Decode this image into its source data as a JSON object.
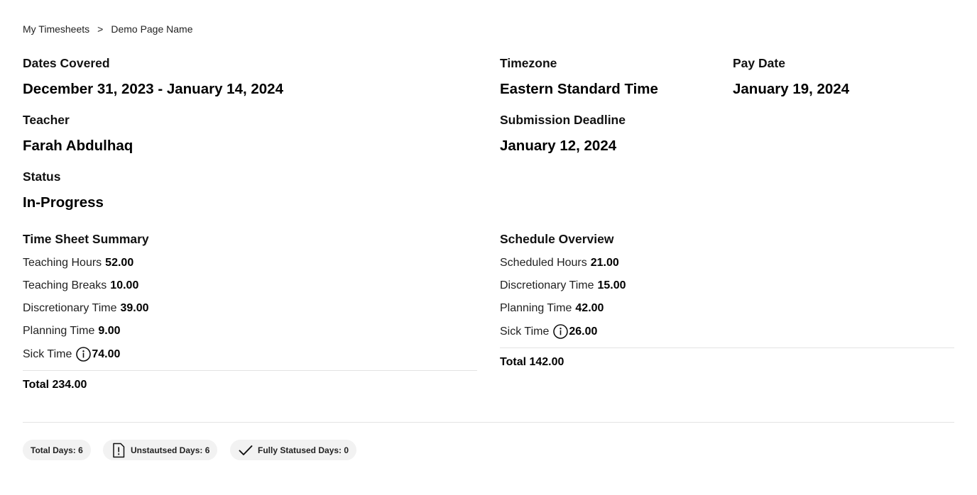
{
  "breadcrumb": {
    "parent": "My Timesheets",
    "separator": ">",
    "current": "Demo Page Name"
  },
  "details": {
    "dates_covered": {
      "label": "Dates Covered",
      "value": "December 31, 2023 - January 14, 2024"
    },
    "timezone": {
      "label": "Timezone",
      "value": "Eastern Standard Time"
    },
    "pay_date": {
      "label": "Pay Date",
      "value": "January 19, 2024"
    },
    "teacher": {
      "label": "Teacher",
      "value": "Farah Abdulhaq"
    },
    "submission_deadline": {
      "label": "Submission Deadline",
      "value": "January 12, 2024"
    },
    "status": {
      "label": "Status",
      "value": "In-Progress"
    }
  },
  "time_sheet_summary": {
    "title": "Time Sheet Summary",
    "rows": [
      {
        "label": "Teaching Hours",
        "value": "52.00"
      },
      {
        "label": "Teaching Breaks",
        "value": "10.00"
      },
      {
        "label": "Discretionary Time",
        "value": "39.00"
      },
      {
        "label": "Planning Time",
        "value": "9.00"
      },
      {
        "label": "Sick Time",
        "value": "74.00",
        "icon": "info-icon"
      }
    ],
    "total": "Total 234.00"
  },
  "schedule_overview": {
    "title": "Schedule Overview",
    "rows": [
      {
        "label": "Scheduled Hours",
        "value": "21.00"
      },
      {
        "label": "Discretionary Time",
        "value": "15.00"
      },
      {
        "label": "Planning Time",
        "value": "42.00"
      },
      {
        "label": "Sick Time",
        "value": "26.00",
        "icon": "info-icon"
      }
    ],
    "total": "Total 142.00"
  },
  "badges": {
    "total_days": "Total Days: 6",
    "unstatused_days": "Unstautsed Days: 6",
    "unstatused_icon": "document-alert-icon",
    "fully_statused_days": "Fully Statused Days: 0",
    "fully_statused_icon": "checkmark-icon"
  }
}
